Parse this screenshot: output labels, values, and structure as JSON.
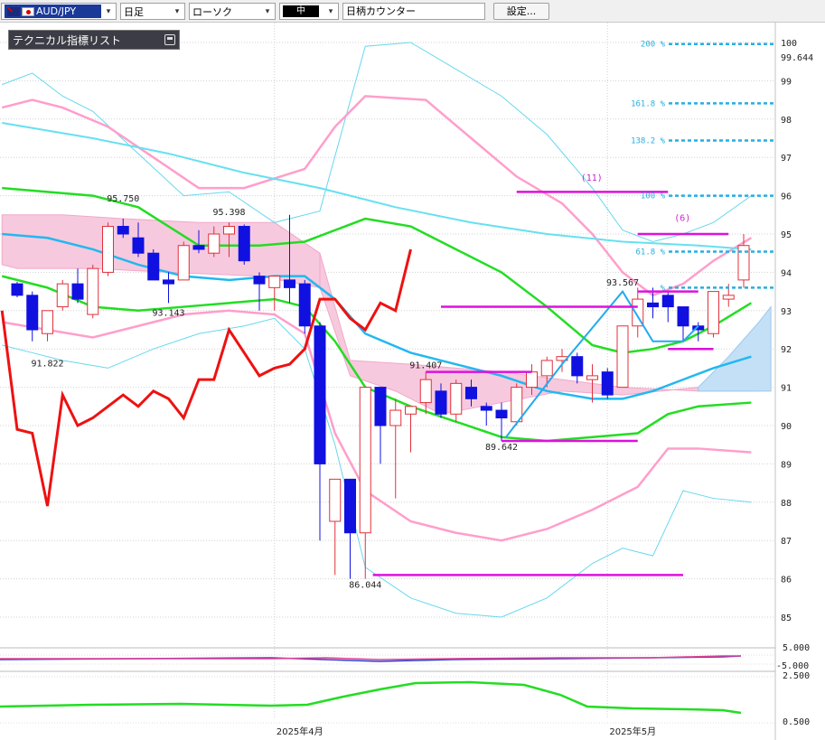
{
  "toolbar": {
    "symbol": "AUD/JPY",
    "timeframe": "日足",
    "chart_type": "ローソク",
    "drawing_tool": "中",
    "counter_input": "日柄カウンター",
    "settings_label": "設定..."
  },
  "indicator_list": {
    "title": "テクニカル指標リスト"
  },
  "colors": {
    "up_candle": "#e0303a",
    "down_candle": "#1010e0",
    "green_line": "#22dd22",
    "pink_line": "#ff9ecb",
    "cyan_line": "#66d8ee",
    "red_line": "#ee1111",
    "fib": "#27aee0",
    "magenta": "#dd11dd"
  },
  "chart_data": {
    "type": "candlestick",
    "symbol": "AUD/JPY",
    "timeframe": "日足",
    "y_ticks": [
      100,
      99,
      98,
      97,
      96,
      95,
      94,
      93,
      92,
      91,
      90,
      89,
      88,
      87,
      86,
      85
    ],
    "current_price": "99.644",
    "ylim": [
      84.15,
      100.2
    ],
    "x_labels": [
      {
        "label": "2025年4月",
        "index": 17
      },
      {
        "label": "2025年5月",
        "index": 39
      }
    ],
    "candles": [
      [
        93.7,
        93.75,
        93.35,
        93.4
      ],
      [
        93.4,
        93.5,
        92.2,
        92.5
      ],
      [
        92.4,
        93.0,
        92.2,
        93.0
      ],
      [
        93.1,
        93.8,
        93.0,
        93.7
      ],
      [
        93.7,
        94.1,
        93.2,
        93.3
      ],
      [
        92.9,
        94.2,
        92.8,
        94.1
      ],
      [
        94.0,
        95.3,
        93.9,
        95.2
      ],
      [
        95.2,
        95.4,
        94.9,
        95.0
      ],
      [
        94.9,
        95.3,
        94.4,
        94.5
      ],
      [
        94.5,
        94.6,
        93.8,
        93.8
      ],
      [
        93.8,
        94.0,
        93.2,
        93.7
      ],
      [
        93.8,
        94.8,
        93.8,
        94.7
      ],
      [
        94.7,
        95.1,
        94.5,
        94.6
      ],
      [
        94.5,
        95.2,
        94.4,
        95.0
      ],
      [
        95.0,
        95.3,
        94.4,
        95.2
      ],
      [
        95.2,
        95.25,
        94.2,
        94.3
      ],
      [
        93.9,
        94.0,
        93.0,
        93.7
      ],
      [
        93.6,
        93.9,
        93.0,
        93.9
      ],
      [
        93.8,
        95.5,
        93.2,
        93.6
      ],
      [
        93.7,
        93.8,
        92.4,
        92.6
      ],
      [
        92.6,
        92.7,
        87.0,
        89.0
      ],
      [
        87.5,
        88.5,
        86.1,
        88.6
      ],
      [
        88.6,
        88.6,
        86.0,
        87.2
      ],
      [
        87.2,
        91.0,
        86.0,
        91.0
      ],
      [
        91.0,
        91.0,
        89.0,
        90.0
      ],
      [
        90.0,
        90.7,
        88.1,
        90.4
      ],
      [
        90.3,
        90.5,
        89.3,
        90.5
      ],
      [
        90.6,
        91.4,
        90.3,
        91.2
      ],
      [
        90.9,
        91.1,
        90.2,
        90.3
      ],
      [
        90.3,
        91.2,
        90.1,
        91.1
      ],
      [
        91.0,
        91.2,
        90.5,
        90.7
      ],
      [
        90.5,
        90.6,
        90.0,
        90.4
      ],
      [
        90.4,
        90.6,
        89.6,
        90.2
      ],
      [
        90.1,
        91.1,
        90.0,
        91.0
      ],
      [
        91.0,
        91.6,
        90.8,
        91.4
      ],
      [
        91.3,
        91.8,
        91.0,
        91.7
      ],
      [
        91.7,
        92.0,
        91.4,
        91.8
      ],
      [
        91.8,
        91.9,
        91.1,
        91.3
      ],
      [
        91.2,
        91.6,
        90.6,
        91.3
      ],
      [
        91.4,
        91.5,
        90.7,
        90.8
      ],
      [
        91.0,
        92.6,
        91.0,
        92.6
      ],
      [
        92.6,
        93.6,
        92.3,
        93.3
      ],
      [
        93.2,
        93.6,
        92.8,
        93.1
      ],
      [
        93.4,
        93.5,
        92.7,
        93.1
      ],
      [
        93.1,
        93.1,
        92.2,
        92.6
      ],
      [
        92.6,
        92.7,
        92.2,
        92.5
      ],
      [
        92.4,
        93.5,
        92.3,
        93.5
      ],
      [
        93.3,
        93.7,
        93.1,
        93.4
      ],
      [
        93.8,
        95.0,
        93.6,
        94.7
      ]
    ],
    "annotations": [
      {
        "label": "95.750",
        "price": 95.75,
        "index": 7
      },
      {
        "label": "95.398",
        "price": 95.4,
        "index": 14
      },
      {
        "label": "93.143",
        "price": 93.143,
        "index": 10
      },
      {
        "label": "91.822",
        "price": 91.822,
        "index": 2
      },
      {
        "label": "86.044",
        "price": 86.044,
        "index": 23
      },
      {
        "label": "91.407",
        "price": 91.407,
        "index": 27
      },
      {
        "label": "89.642",
        "price": 89.642,
        "index": 32
      },
      {
        "label": "93.567",
        "price": 93.567,
        "index": 40
      }
    ],
    "fibonacci": [
      {
        "label": "200 %",
        "price": 99.96
      },
      {
        "label": "161.8 %",
        "price": 98.41
      },
      {
        "label": "138.2 %",
        "price": 97.44
      },
      {
        "label": "100 %",
        "price": 96.0
      },
      {
        "label": "61.8 %",
        "price": 94.54
      },
      {
        "label": "%",
        "price": 93.6
      }
    ],
    "count_labels": [
      {
        "label": "(11)",
        "price": 96.32,
        "index": 37
      },
      {
        "label": "(6)",
        "price": 95.27,
        "index": 43
      }
    ],
    "sub_panel_1": {
      "ticks": [
        "5.000",
        "-5.000"
      ]
    },
    "sub_panel_2": {
      "ticks": [
        "2.500",
        "0.500"
      ]
    }
  }
}
